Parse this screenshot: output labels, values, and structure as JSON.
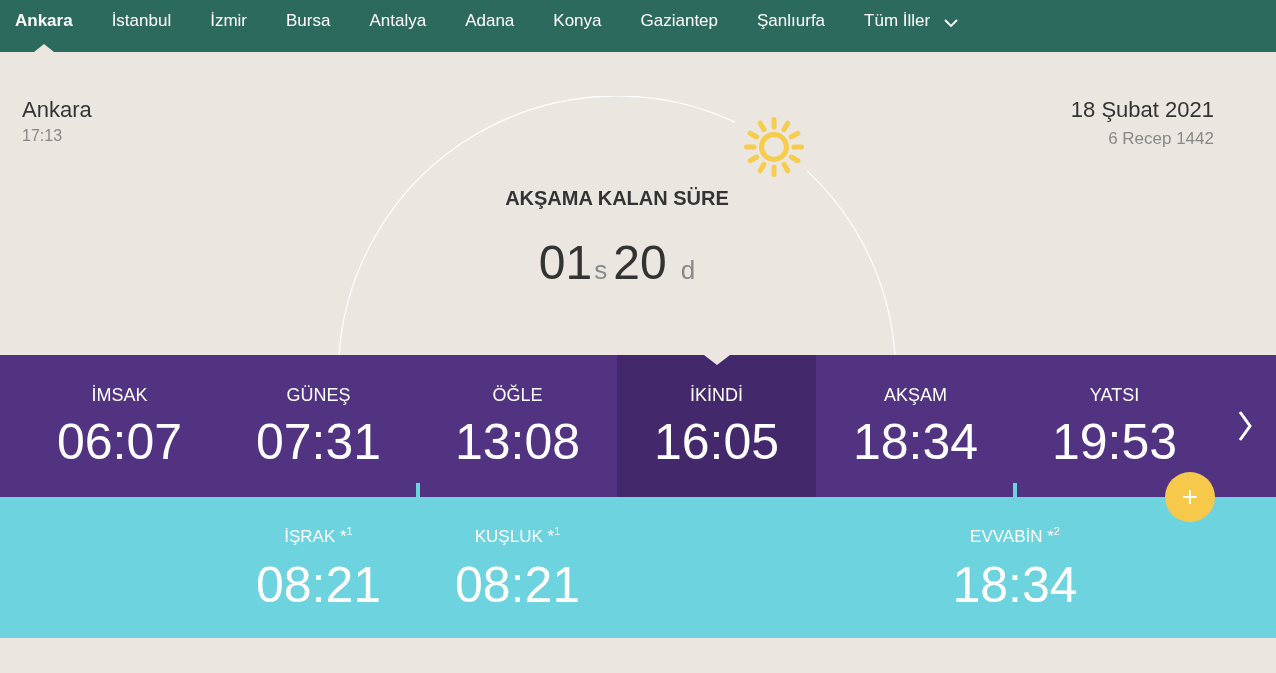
{
  "nav": {
    "cities": [
      {
        "label": "Ankara",
        "selected": true
      },
      {
        "label": "İstanbul",
        "selected": false
      },
      {
        "label": "İzmir",
        "selected": false
      },
      {
        "label": "Bursa",
        "selected": false
      },
      {
        "label": "Antalya",
        "selected": false
      },
      {
        "label": "Adana",
        "selected": false
      },
      {
        "label": "Konya",
        "selected": false
      },
      {
        "label": "Gaziantep",
        "selected": false
      },
      {
        "label": "Şanlıurfa",
        "selected": false
      }
    ],
    "all_cities": {
      "label": "Tüm İller"
    }
  },
  "location": {
    "city": "Ankara",
    "time": "17:13"
  },
  "date": {
    "gregorian": "18 Şubat 2021",
    "hijri": "6 Recep 1442"
  },
  "countdown": {
    "title": "AKŞAMA KALAN SÜRE",
    "hours": "01",
    "hours_unit": "s",
    "minutes": "20",
    "minutes_unit": "d"
  },
  "prayer_times": [
    {
      "name": "İMSAK",
      "time": "06:07",
      "selected": false,
      "marker": false
    },
    {
      "name": "GÜNEŞ",
      "time": "07:31",
      "selected": false,
      "marker": true
    },
    {
      "name": "ÖĞLE",
      "time": "13:08",
      "selected": false,
      "marker": false
    },
    {
      "name": "İKİNDİ",
      "time": "16:05",
      "selected": true,
      "marker": false
    },
    {
      "name": "AKŞAM",
      "time": "18:34",
      "selected": false,
      "marker": true
    },
    {
      "name": "YATSI",
      "time": "19:53",
      "selected": false,
      "marker": false
    }
  ],
  "extra_times": [
    {
      "name": "İŞRAK *$^{1}$",
      "time": "08:21"
    },
    {
      "name": "KUŞLUK *$^{1}$",
      "time": "08:21"
    },
    {
      "name": "EVVABİN *$^{2}$",
      "time": "18:34"
    }
  ],
  "add_button": {
    "label": "+"
  }
}
